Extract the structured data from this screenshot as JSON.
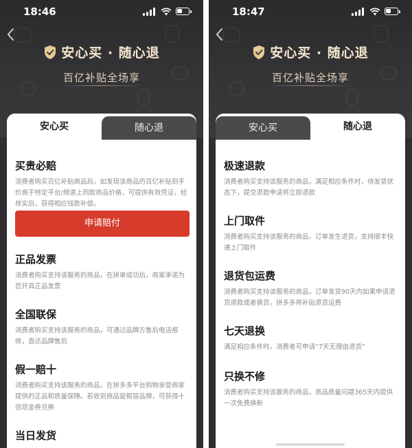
{
  "left": {
    "status_time": "18:46",
    "hero_title": "安心买 · 随心退",
    "hero_subtitle": "百亿补贴全场享",
    "tabs": [
      "安心买",
      "随心退"
    ],
    "active_tab": "安心买",
    "sections": [
      {
        "title": "买贵必赔",
        "desc": "消费者购买百亿补贴商品后，如发现该商品的百亿补贴到手价高于特定平台/频道上同款商品价格，可提供有效凭证，经核实后，获得相应钱款补偿。"
      },
      {
        "title": "正品发票",
        "desc": "消费者购买支持该服务的商品，在拼单成功后，商家承诺为您开具正品发票"
      },
      {
        "title": "全国联保",
        "desc": "消费者购买支持该服务的商品，可通过品牌方售后电话报修，直达品牌售后"
      },
      {
        "title": "假一赔十",
        "desc": "消费者购买支持该服务的商品，在拼多多平台购物享受商家提供的正品和质量保障。若收到商品是假冒品牌，可获得十倍现金券兑换"
      },
      {
        "title": "当日发货",
        "desc": ""
      }
    ],
    "claim_button": "申请赔付"
  },
  "right": {
    "status_time": "18:47",
    "hero_title": "安心买 · 随心退",
    "hero_subtitle": "百亿补贴全场享",
    "tabs": [
      "安心买",
      "随心退"
    ],
    "active_tab": "随心退",
    "sections": [
      {
        "title": "极速退款",
        "desc": "消费者购买支持该服务的商品，满足相应条件时，待发货状态下，提交退款申请将立即退款"
      },
      {
        "title": "上门取件",
        "desc": "消费者购买支持该服务的商品，订单发生退货，支持顺丰快递上门取件"
      },
      {
        "title": "退货包运费",
        "desc": "消费者购买支持该服务的商品，订单发货90天内如果申请退货退款或者换货，拼多多将补贴退货运费"
      },
      {
        "title": "七天退换",
        "desc": "满足相应条件时，消费者可申请“7天无理由退货”"
      },
      {
        "title": "只换不修",
        "desc": "消费者购买支持该服务的商品，商品质量问题365天内提供一次免费换新"
      }
    ]
  },
  "colors": {
    "hero_bg": "#2f2f31",
    "gold_text": "#f6e6cf",
    "accent_red": "#d63b2b",
    "gray_desc": "#8c8c8c"
  },
  "icons": [
    "back-chevron-icon",
    "shield-check-icon",
    "signal-icon",
    "wifi-icon",
    "battery-icon"
  ]
}
